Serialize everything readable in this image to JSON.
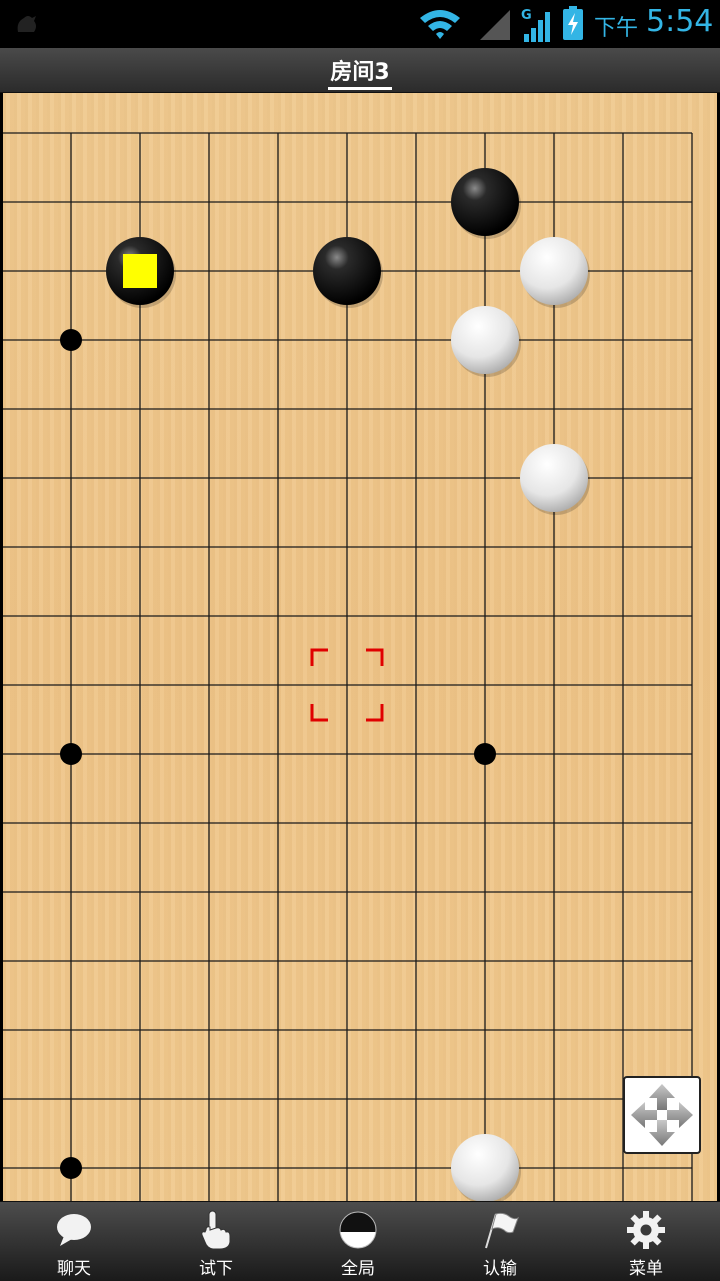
{
  "status_bar": {
    "time_prefix": "下午",
    "time": "5:54",
    "signal_type": "G",
    "icons": [
      "app-icon",
      "wifi-icon",
      "signal-empty-icon",
      "signal-g-icon",
      "battery-charging-icon"
    ]
  },
  "title": "房间3",
  "board": {
    "visible_columns": 11,
    "visible_rows": 16,
    "star_points": [
      [
        1,
        3
      ],
      [
        1,
        9
      ],
      [
        1,
        15
      ],
      [
        7,
        9
      ]
    ],
    "stones": [
      {
        "color": "black",
        "col": 7,
        "row": 1
      },
      {
        "color": "black",
        "col": 2,
        "row": 2,
        "marker": "last-move"
      },
      {
        "color": "black",
        "col": 5,
        "row": 2
      },
      {
        "color": "white",
        "col": 8,
        "row": 2
      },
      {
        "color": "white",
        "col": 7,
        "row": 3
      },
      {
        "color": "white",
        "col": 8,
        "row": 5
      },
      {
        "color": "white",
        "col": 7,
        "row": 15
      }
    ],
    "cursor": {
      "col": 5,
      "row": 8
    },
    "colors": {
      "line": "#1a1a1a",
      "wood": "#eec488",
      "last_move_marker": "#ffff00",
      "cursor": "#e00000"
    }
  },
  "move_button_icon": "four-way-arrows-icon",
  "toolbar": [
    {
      "label": "聊天",
      "icon": "chat-bubble-icon"
    },
    {
      "label": "试下",
      "icon": "pointing-hand-icon"
    },
    {
      "label": "全局",
      "icon": "half-black-white-stone-icon"
    },
    {
      "label": "认输",
      "icon": "white-flag-icon"
    },
    {
      "label": "菜单",
      "icon": "gear-icon"
    }
  ]
}
